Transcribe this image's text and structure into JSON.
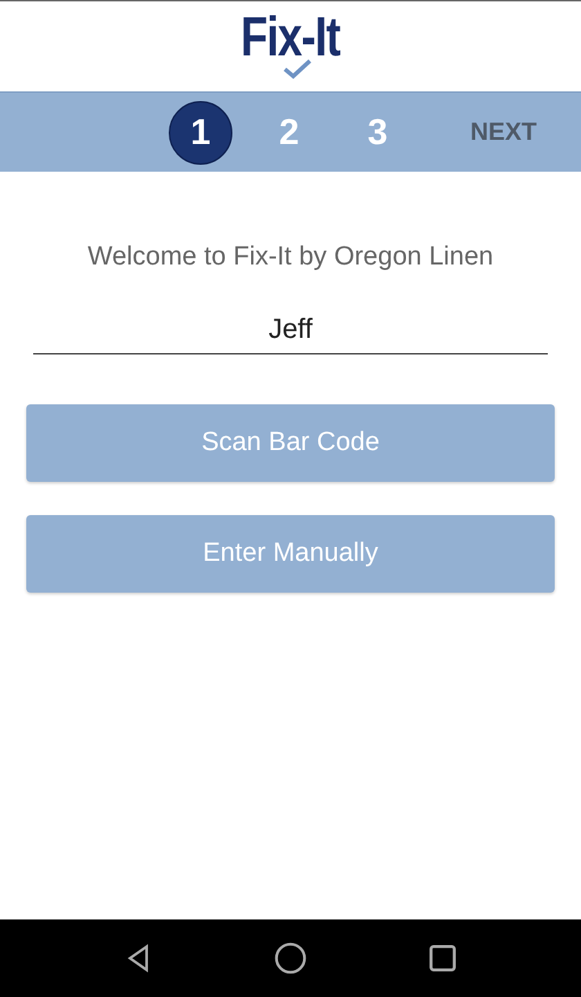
{
  "logo": {
    "text": "Fix-It"
  },
  "steps": [
    {
      "label": "1",
      "selected": true
    },
    {
      "label": "2",
      "selected": false
    },
    {
      "label": "3",
      "selected": false
    }
  ],
  "next": {
    "label": "NEXT",
    "disabled": true
  },
  "welcome": "Welcome to Fix-It by Oregon Linen",
  "name_field": {
    "value": "Jeff"
  },
  "buttons": [
    "Scan Bar Code",
    "Enter Manually"
  ]
}
